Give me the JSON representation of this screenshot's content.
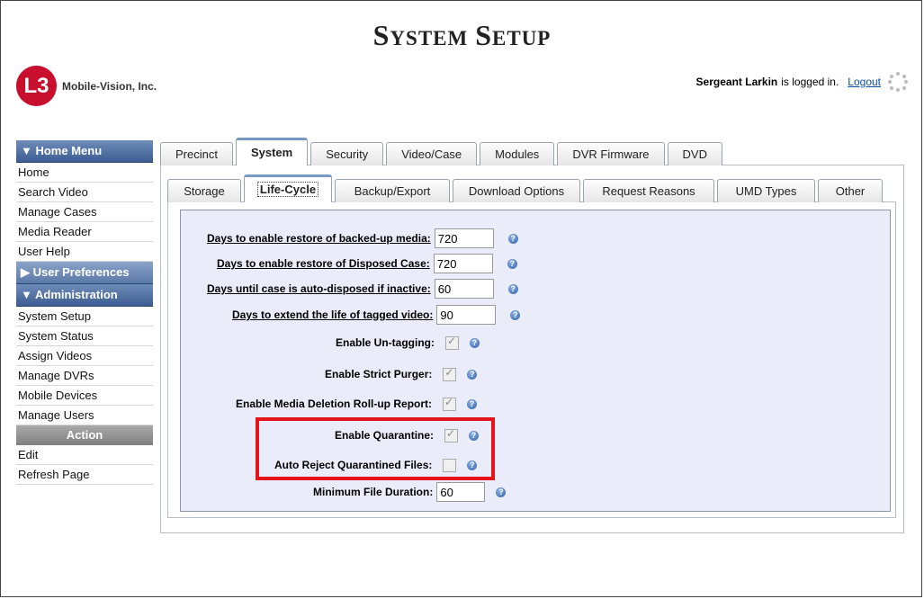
{
  "header": {
    "title_first_s": "S",
    "title_ystem": "YSTEM",
    "title_s2": "S",
    "title_etup": "ETUP",
    "logo_mark": "L3",
    "company": "Mobile-Vision, Inc.",
    "user": "Sergeant Larkin",
    "logged_in": "is logged in.",
    "logout": "Logout"
  },
  "sidebar": {
    "home_menu": "▼  Home Menu",
    "home_items": [
      "Home",
      "Search Video",
      "Manage Cases",
      "Media Reader",
      "User Help"
    ],
    "user_prefs": "▶  User Preferences",
    "administration": "▼  Administration",
    "admin_items": [
      "System Setup",
      "System Status",
      "Assign Videos",
      "Manage DVRs",
      "Mobile Devices",
      "Manage Users"
    ],
    "action": "Action",
    "action_items": [
      "Edit",
      "Refresh Page"
    ]
  },
  "tabs": [
    "Precinct",
    "System",
    "Security",
    "Video/Case",
    "Modules",
    "DVR Firmware",
    "DVD"
  ],
  "subtabs": [
    "Storage",
    "Life-Cycle",
    "Backup/Export",
    "Download Options",
    "Request Reasons",
    "UMD Types",
    "Other"
  ],
  "form": {
    "restore_backed_label": "Days to enable restore of backed-up media:",
    "restore_backed_value": "720",
    "restore_disposed_label": "Days to enable restore of Disposed Case:",
    "restore_disposed_value": "720",
    "auto_disposed_label": "Days until case is auto-disposed if inactive:",
    "auto_disposed_value": "60",
    "extend_tagged_label": "Days to extend the life of tagged video:",
    "extend_tagged_value": "90",
    "untagging_label": "Enable Un-tagging:",
    "strict_purger_label": "Enable Strict Purger:",
    "rollup_label": "Enable Media Deletion Roll-up Report:",
    "quarantine_label": "Enable Quarantine:",
    "auto_reject_label": "Auto Reject Quarantined Files:",
    "min_duration_label": "Minimum File Duration:",
    "min_duration_value": "60",
    "help_glyph": "?"
  },
  "colors": {
    "highlight": "#e3151a",
    "form_bg": "#eaedf9",
    "brand": "#c8102e"
  }
}
